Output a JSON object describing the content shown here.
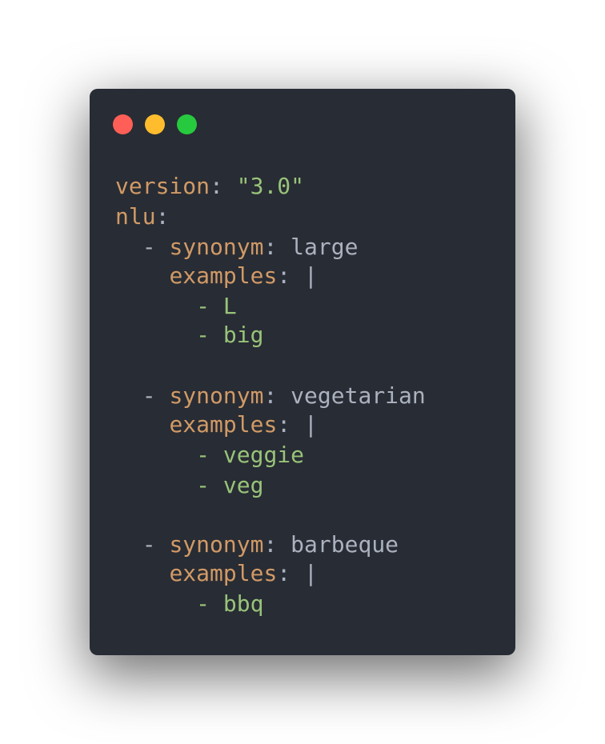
{
  "colors": {
    "background": "#ffffff",
    "window_bg": "#282c34",
    "close_dot": "#ff5f56",
    "minimize_dot": "#ffbd2e",
    "zoom_dot": "#27c93f",
    "key": "#d19a66",
    "punctuation": "#abb2bf",
    "string": "#98c379",
    "plain_value": "#abb2bf"
  },
  "window_controls": {
    "close": "close-dot",
    "minimize": "minimize-dot",
    "zoom": "zoom-dot"
  },
  "code": {
    "line1": {
      "key": "version",
      "colon": ": ",
      "value": "\"3.0\""
    },
    "line2": {
      "key": "nlu",
      "colon": ":"
    },
    "block1": {
      "dash": "- ",
      "key": "synonym",
      "colon": ": ",
      "value": "large",
      "examples_key": "examples",
      "examples_colon": ": |",
      "items": [
        "- L",
        "- big"
      ]
    },
    "block2": {
      "dash": "- ",
      "key": "synonym",
      "colon": ": ",
      "value": "vegetarian",
      "examples_key": "examples",
      "examples_colon": ": |",
      "items": [
        "- veggie",
        "- veg"
      ]
    },
    "block3": {
      "dash": "- ",
      "key": "synonym",
      "colon": ": ",
      "value": "barbeque",
      "examples_key": "examples",
      "examples_colon": ": |",
      "items": [
        "- bbq"
      ]
    }
  }
}
